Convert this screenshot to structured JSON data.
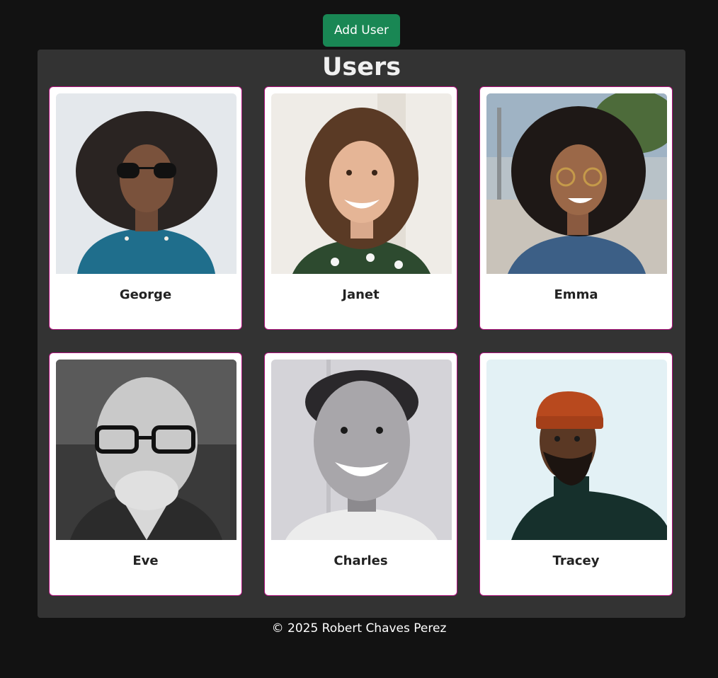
{
  "header": {
    "add_user_label": "Add User",
    "add_user_color": "#198754"
  },
  "panel": {
    "title": "Users"
  },
  "users": [
    {
      "name": "George"
    },
    {
      "name": "Janet"
    },
    {
      "name": "Emma"
    },
    {
      "name": "Eve"
    },
    {
      "name": "Charles"
    },
    {
      "name": "Tracey"
    }
  ],
  "footer": {
    "text": "© 2025 Robert Chaves Perez"
  },
  "colors": {
    "page_background": "#121212",
    "panel_background": "#333333",
    "card_border": "#b0127e"
  }
}
